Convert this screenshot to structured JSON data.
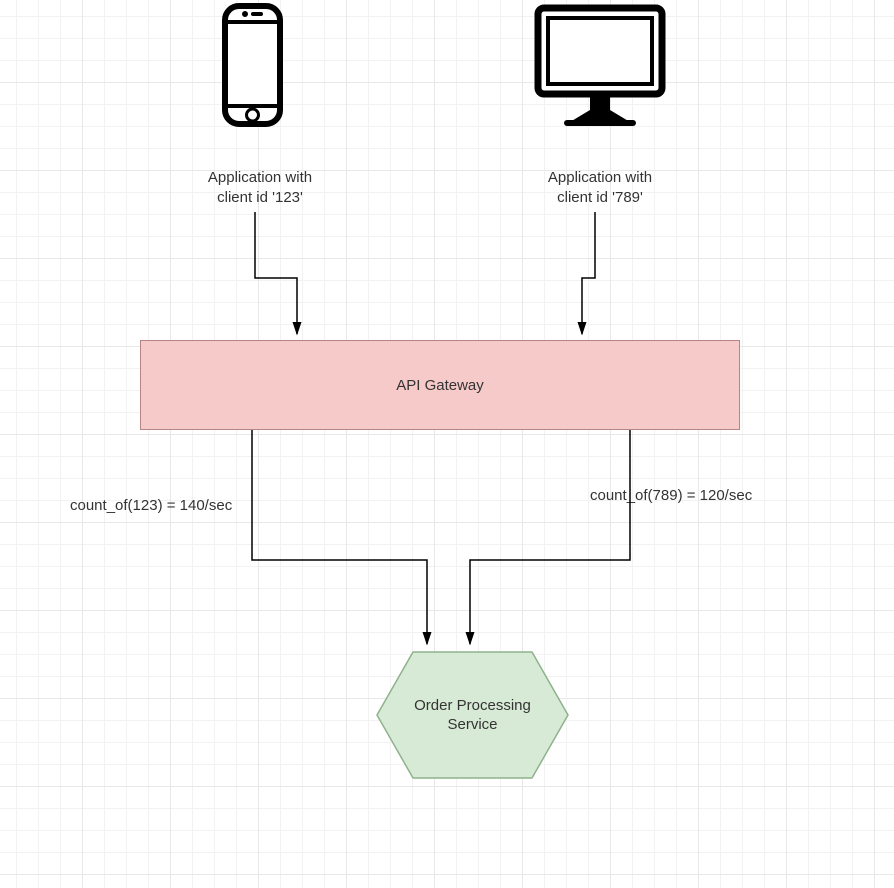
{
  "clients": {
    "mobile": {
      "label_line1": "Application with",
      "label_line2": "client id '123'"
    },
    "desktop": {
      "label_line1": "Application with",
      "label_line2": "client id '789'"
    }
  },
  "gateway": {
    "label": "API Gateway"
  },
  "counts": {
    "left": "count_of(123) = 140/sec",
    "right": "count_of(789) = 120/sec"
  },
  "service": {
    "line1": "Order Processing",
    "line2": "Service"
  }
}
